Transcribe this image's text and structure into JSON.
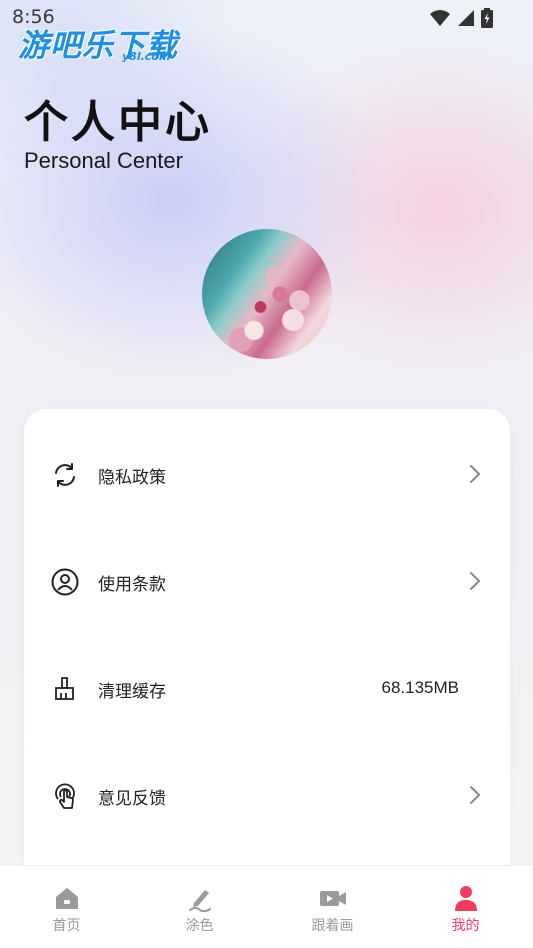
{
  "status_bar": {
    "time": "8:56"
  },
  "watermark": {
    "name": "游吧乐下载",
    "domain": "y8l.com"
  },
  "header": {
    "title": "个人中心",
    "subtitle": "Personal Center"
  },
  "menu": {
    "items": [
      {
        "label": "隐私政策",
        "icon": "refresh-icon",
        "value": "",
        "chevron": true
      },
      {
        "label": "使用条款",
        "icon": "user-circle-icon",
        "value": "",
        "chevron": true
      },
      {
        "label": "清理缓存",
        "icon": "broom-icon",
        "value": "68.135MB",
        "chevron": false
      },
      {
        "label": "意见反馈",
        "icon": "touch-icon",
        "value": "",
        "chevron": true
      }
    ]
  },
  "tabbar": {
    "tabs": [
      {
        "label": "首页",
        "icon": "home-icon",
        "active": false
      },
      {
        "label": "涂色",
        "icon": "pencil-icon",
        "active": false
      },
      {
        "label": "跟着画",
        "icon": "video-icon",
        "active": false
      },
      {
        "label": "我的",
        "icon": "person-icon",
        "active": true
      }
    ]
  },
  "colors": {
    "accent": "#f23b5f",
    "inactive": "#9a9a9a",
    "watermark": "#1d8fe8"
  }
}
